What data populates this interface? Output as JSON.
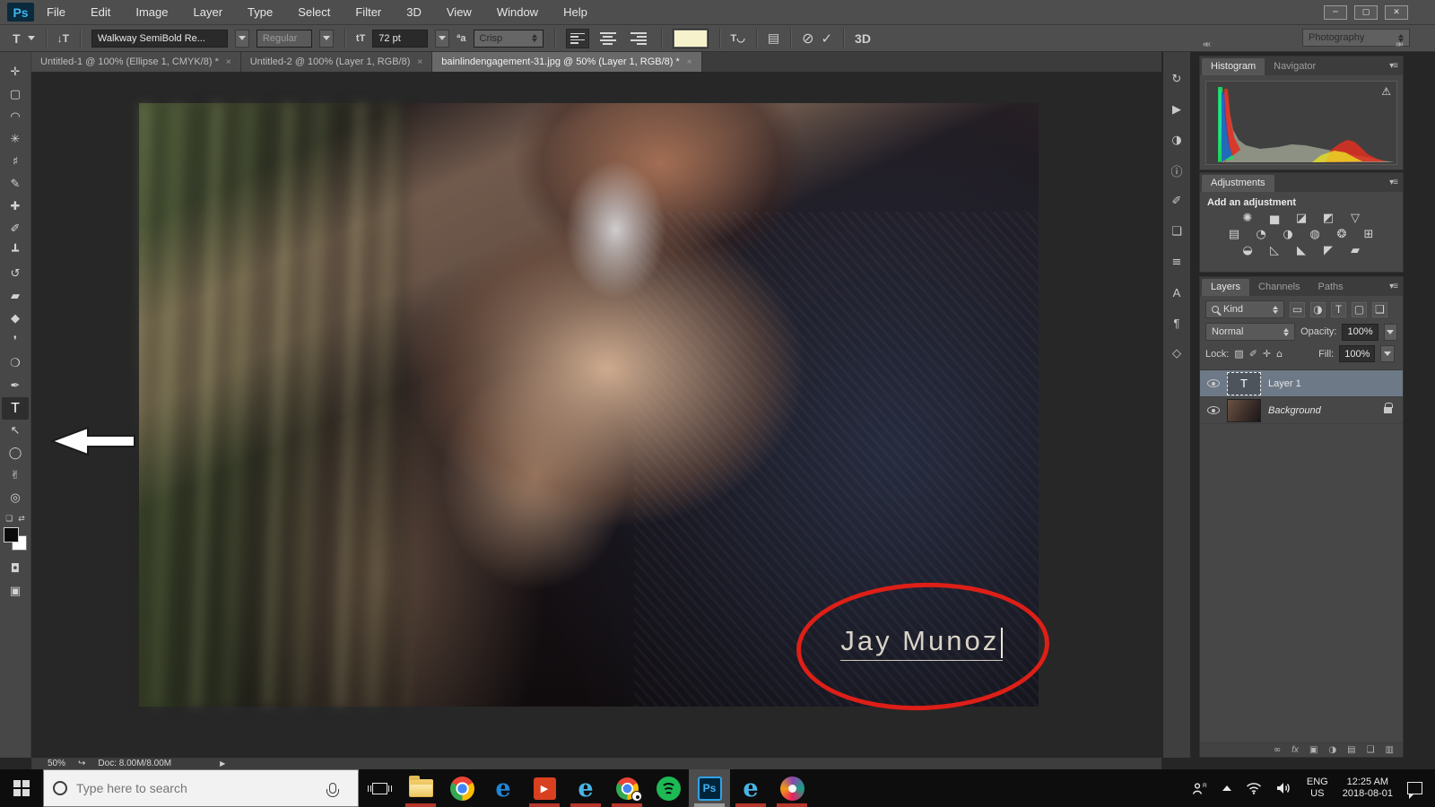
{
  "menu_bar": {
    "logo": "Ps",
    "items": [
      "File",
      "Edit",
      "Image",
      "Layer",
      "Type",
      "Select",
      "Filter",
      "3D",
      "View",
      "Window",
      "Help"
    ]
  },
  "window_controls": {
    "minimize": "─",
    "restore": "▢",
    "close": "✕"
  },
  "options_bar": {
    "tool_glyph": "T",
    "orientation_glyph": "↓T",
    "font_family": "Walkway SemiBold Re...",
    "font_style": "Regular",
    "size_glyph": "tT",
    "font_size": "72 pt",
    "aa_glyph": "ªa",
    "anti_alias": "Crisp",
    "warp_glyph": "T◡",
    "panels_glyph": "▤",
    "cancel_glyph": "⊘",
    "commit_glyph": "✓",
    "threed_label": "3D",
    "workspace": "Photography"
  },
  "document_tabs": [
    {
      "label": "Untitled-1 @ 100% (Ellipse 1, CMYK/8) *",
      "close": "×"
    },
    {
      "label": "Untitled-2 @ 100% (Layer 1, RGB/8)",
      "close": "×"
    },
    {
      "label": "bainlindengagement-31.jpg @ 50% (Layer 1, RGB/8) *",
      "close": "×"
    }
  ],
  "tools": [
    {
      "name": "move",
      "glyph": "✛"
    },
    {
      "name": "rectangular-marquee",
      "glyph": "▢"
    },
    {
      "name": "lasso",
      "glyph": "◠"
    },
    {
      "name": "quick-selection",
      "glyph": "✳"
    },
    {
      "name": "crop",
      "glyph": "♯"
    },
    {
      "name": "eyedropper",
      "glyph": "✎"
    },
    {
      "name": "spot-healing-brush",
      "glyph": "✚"
    },
    {
      "name": "brush",
      "glyph": "✐"
    },
    {
      "name": "clone-stamp",
      "glyph": "┻"
    },
    {
      "name": "history-brush",
      "glyph": "↺"
    },
    {
      "name": "eraser",
      "glyph": "▰"
    },
    {
      "name": "gradient",
      "glyph": "◆"
    },
    {
      "name": "blur",
      "glyph": "❜"
    },
    {
      "name": "dodge",
      "glyph": "❍"
    },
    {
      "name": "pen",
      "glyph": "✒"
    },
    {
      "name": "type",
      "glyph": "T"
    },
    {
      "name": "path-selection",
      "glyph": "↖"
    },
    {
      "name": "ellipse",
      "glyph": "◯"
    },
    {
      "name": "hand",
      "glyph": "✌"
    },
    {
      "name": "zoom",
      "glyph": "◎"
    }
  ],
  "toolbar_extras": {
    "swap_glyph": "⇄",
    "default_glyph": "❏",
    "quickmask_glyph": "◘",
    "screenmode_glyph": "▣"
  },
  "side_strip": [
    {
      "name": "history",
      "glyph": "↻"
    },
    {
      "name": "actions",
      "glyph": "▶"
    },
    {
      "name": "styles",
      "glyph": "◑"
    },
    {
      "name": "info",
      "glyph": "ⓘ"
    },
    {
      "name": "brush-settings",
      "glyph": "✐"
    },
    {
      "name": "clone-source",
      "glyph": "❏"
    },
    {
      "name": "layer-comps",
      "glyph": "≡"
    },
    {
      "name": "character",
      "glyph": "A"
    },
    {
      "name": "paragraph",
      "glyph": "¶"
    },
    {
      "name": "3d",
      "glyph": "◇"
    }
  ],
  "panels": {
    "collapse_left": "««",
    "collapse_right": "»»",
    "histogram": {
      "tab_histogram": "Histogram",
      "tab_navigator": "Navigator",
      "warning_glyph": "⚠",
      "menu_glyph": "▾≡"
    },
    "adjustments": {
      "tab": "Adjustments",
      "subtitle": "Add an adjustment",
      "row1": [
        {
          "name": "brightness-contrast",
          "glyph": "✺"
        },
        {
          "name": "levels",
          "glyph": "▅"
        },
        {
          "name": "curves",
          "glyph": "◪"
        },
        {
          "name": "exposure",
          "glyph": "◩"
        },
        {
          "name": "vibrance",
          "glyph": "▽"
        }
      ],
      "row2": [
        {
          "name": "hue-saturation",
          "glyph": "▤"
        },
        {
          "name": "color-balance",
          "glyph": "◔"
        },
        {
          "name": "black-white",
          "glyph": "◑"
        },
        {
          "name": "photo-filter",
          "glyph": "◍"
        },
        {
          "name": "channel-mixer",
          "glyph": "❂"
        },
        {
          "name": "color-lookup",
          "glyph": "⊞"
        }
      ],
      "row3": [
        {
          "name": "invert",
          "glyph": "◒"
        },
        {
          "name": "posterize",
          "glyph": "◺"
        },
        {
          "name": "threshold",
          "glyph": "◣"
        },
        {
          "name": "gradient-map",
          "glyph": "◤"
        },
        {
          "name": "selective-color",
          "glyph": "▰"
        }
      ]
    },
    "layers": {
      "tab_layers": "Layers",
      "tab_channels": "Channels",
      "tab_paths": "Paths",
      "kind_label": "Kind",
      "filters": [
        {
          "name": "filter-pixel",
          "glyph": "▭"
        },
        {
          "name": "filter-adjustment",
          "glyph": "◑"
        },
        {
          "name": "filter-type",
          "glyph": "T"
        },
        {
          "name": "filter-shape",
          "glyph": "▢"
        },
        {
          "name": "filter-smart",
          "glyph": "❑"
        }
      ],
      "blend_mode": "Normal",
      "opacity_label": "Opacity:",
      "opacity_value": "100%",
      "lock_label": "Lock:",
      "locks": [
        {
          "name": "lock-transparency",
          "glyph": "▨"
        },
        {
          "name": "lock-paint",
          "glyph": "✐"
        },
        {
          "name": "lock-position",
          "glyph": "✛"
        },
        {
          "name": "lock-all",
          "glyph": "⌂"
        }
      ],
      "fill_label": "Fill:",
      "fill_value": "100%",
      "layer1": {
        "name": "Layer 1",
        "thumb_glyph": "T"
      },
      "background": {
        "name": "Background"
      },
      "bottom_icons": [
        {
          "name": "link-layers",
          "glyph": "∞"
        },
        {
          "name": "layer-effects",
          "glyph": "fx"
        },
        {
          "name": "layer-mask",
          "glyph": "▣"
        },
        {
          "name": "new-adjustment-layer",
          "glyph": "◑"
        },
        {
          "name": "new-group",
          "glyph": "▤"
        },
        {
          "name": "new-layer",
          "glyph": "❑"
        },
        {
          "name": "delete-layer",
          "glyph": "▥"
        }
      ]
    }
  },
  "canvas": {
    "text": "Jay Munoz"
  },
  "status_bar": {
    "zoom": "50%",
    "share_glyph": "↪",
    "doc": "Doc: 8.00M/8.00M",
    "arrow_glyph": "▶"
  },
  "taskbar": {
    "search_placeholder": "Type here to search",
    "apps": [
      {
        "name": "file-explorer"
      },
      {
        "name": "chrome"
      },
      {
        "name": "edge",
        "glyph": "e"
      },
      {
        "name": "movies-tv",
        "glyph": "▶"
      },
      {
        "name": "internet-explorer",
        "glyph": "e"
      },
      {
        "name": "chrome-game"
      },
      {
        "name": "spotify"
      },
      {
        "name": "photoshop",
        "glyph": "Ps"
      },
      {
        "name": "internet-explorer-2",
        "glyph": "e"
      },
      {
        "name": "paint-3d"
      }
    ],
    "tray": {
      "lang_top": "ENG",
      "lang_bottom": "US",
      "time": "12:25 AM",
      "date": "2018-08-01"
    }
  },
  "colors": {
    "accent_blue": "#31a8ff",
    "annotation_red": "#de1f17",
    "swatch_cream": "#f5f2cc"
  }
}
